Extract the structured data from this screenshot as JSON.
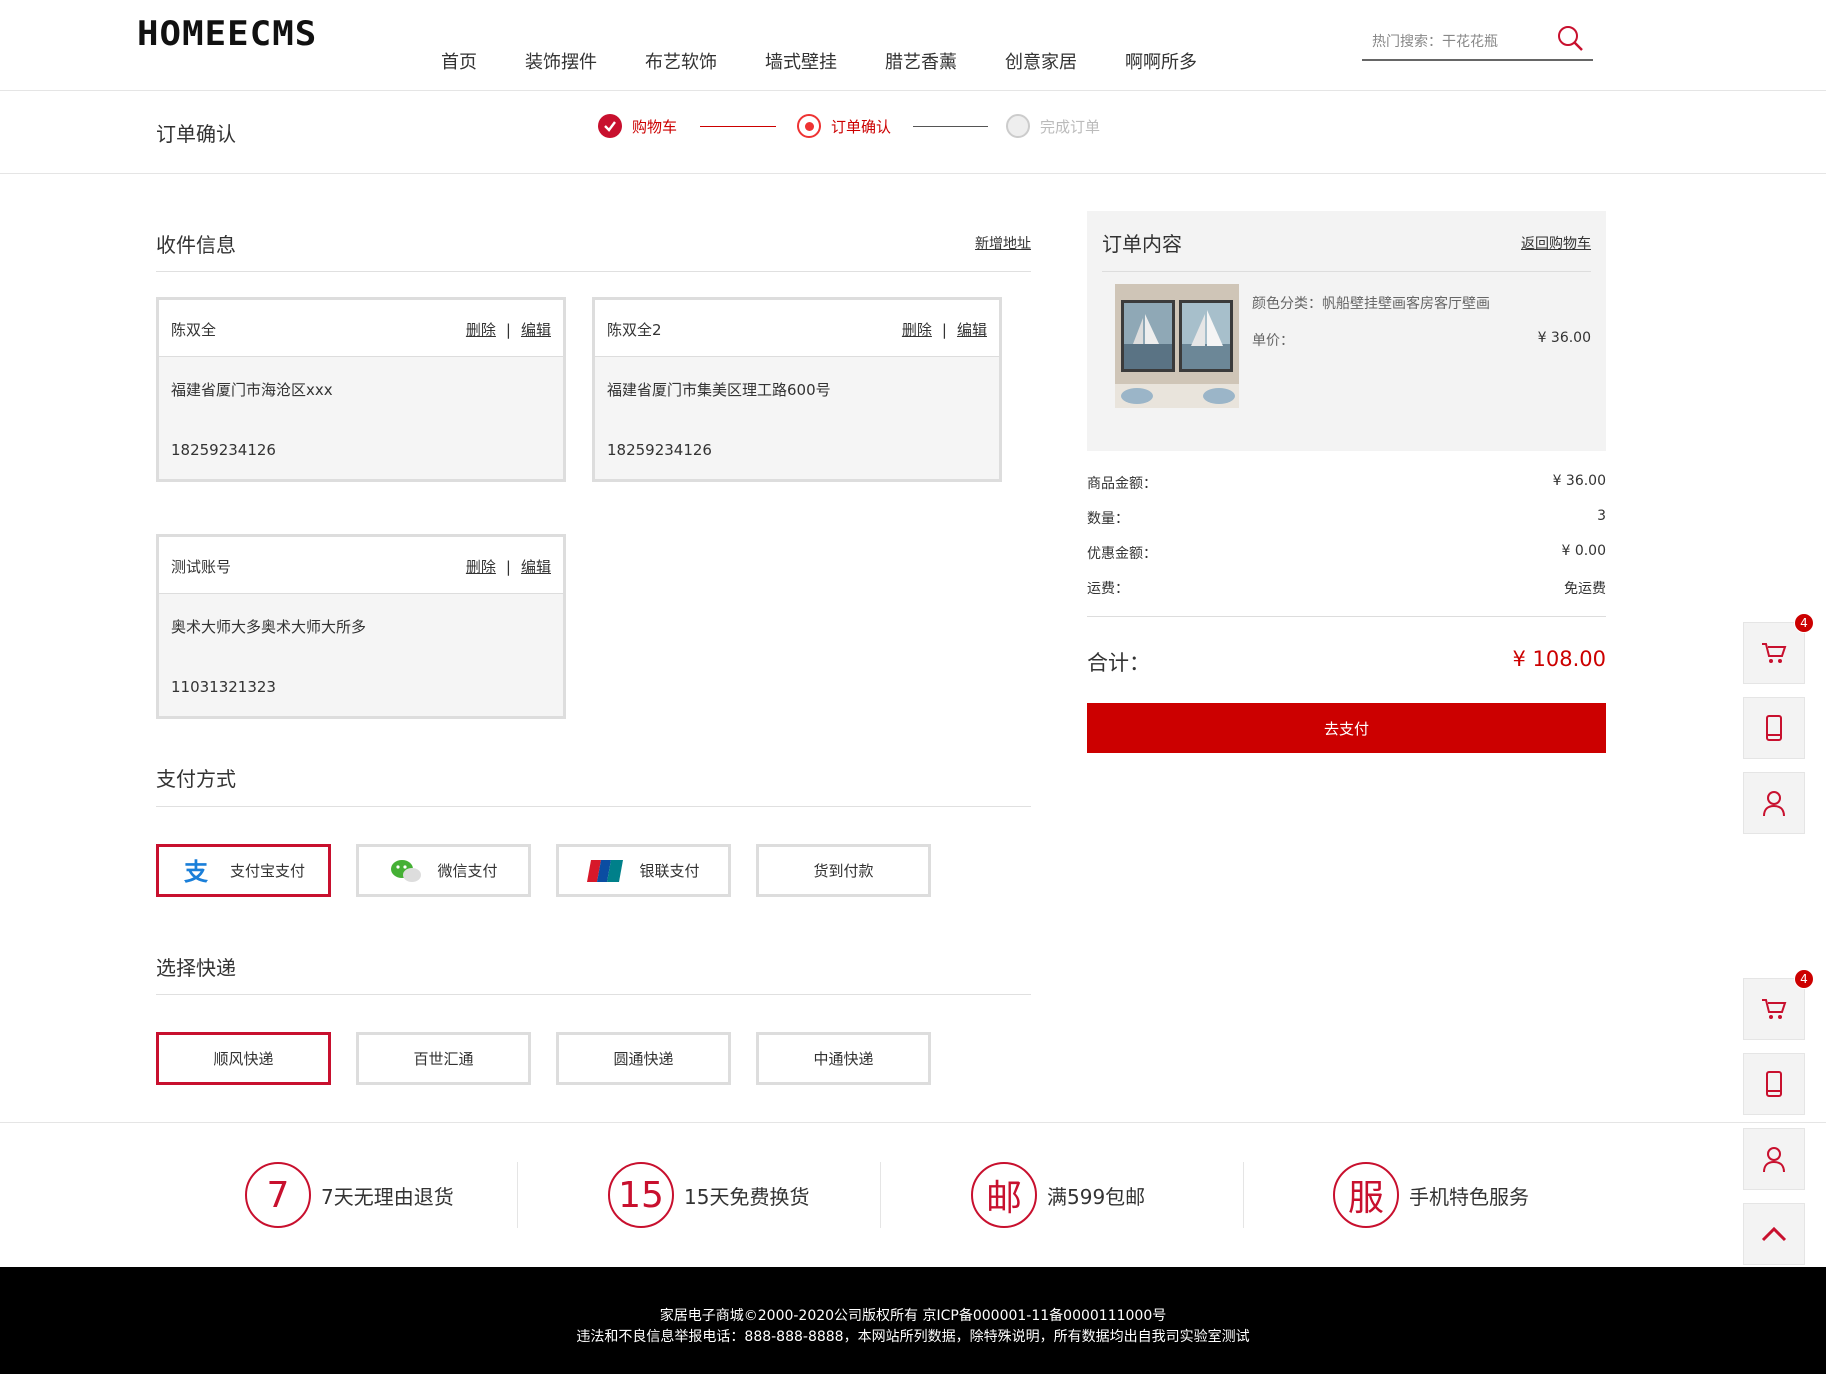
{
  "header": {
    "logo": "HOMEECMS",
    "nav": [
      "首页",
      "装饰摆件",
      "布艺软饰",
      "墙式壁挂",
      "腊艺香薰",
      "创意家居",
      "啊啊所多"
    ],
    "search_label": "热门搜索：干花花瓶"
  },
  "steps": {
    "page_title": "订单确认",
    "items": [
      "购物车",
      "订单确认",
      "完成订单"
    ]
  },
  "shipping": {
    "title": "收件信息",
    "add_link": "新增地址",
    "delete_label": "删除",
    "edit_label": "编辑",
    "separator": "|",
    "addresses": [
      {
        "name": "陈双全",
        "address": "福建省厦门市海沧区xxx",
        "phone": "18259234126"
      },
      {
        "name": "陈双全2",
        "address": "福建省厦门市集美区理工路600号",
        "phone": "18259234126"
      },
      {
        "name": "测试账号",
        "address": "奥术大师大多奥术大师大所多",
        "phone": "11031321323"
      }
    ]
  },
  "payment": {
    "title": "支付方式",
    "options": [
      "支付宝支付",
      "微信支付",
      "银联支付",
      "货到付款"
    ],
    "selected": "支付宝支付"
  },
  "express": {
    "title": "选择快递",
    "options": [
      "顺风快递",
      "百世汇通",
      "圆通快递",
      "中通快递"
    ],
    "selected": "顺风快递"
  },
  "order": {
    "title": "订单内容",
    "back_link": "返回购物车",
    "product_desc": "颜色分类：帆船壁挂壁画客房客厅壁画",
    "unit_label": "单价：",
    "unit_price": "¥ 36.00",
    "summary": [
      {
        "label": "商品金额：",
        "value": "¥ 36.00"
      },
      {
        "label": "数量：",
        "value": "3"
      },
      {
        "label": "优惠金额：",
        "value": "¥ 0.00"
      },
      {
        "label": "运费：",
        "value": "免运费"
      }
    ],
    "total_label": "合计：",
    "total_value": "¥ 108.00",
    "pay_button": "去支付"
  },
  "floats": {
    "cart_badge": "4"
  },
  "services": [
    {
      "icon": "7",
      "text": "7天无理由退货"
    },
    {
      "icon": "15",
      "text": "15天免费换货"
    },
    {
      "icon": "邮",
      "text": "满599包邮"
    },
    {
      "icon": "服",
      "text": "手机特色服务"
    }
  ],
  "footer": {
    "line1": "家居电子商城©2000-2020公司版权所有 京ICP备000001-11备0000111000号",
    "line2": "违法和不良信息举报电话：888-888-8888，本网站所列数据，除特殊说明，所有数据均出自我司实验室测试"
  },
  "colors": {
    "accent": "#c8102e",
    "price": "#cc0000",
    "footer_bg": "#000000"
  }
}
